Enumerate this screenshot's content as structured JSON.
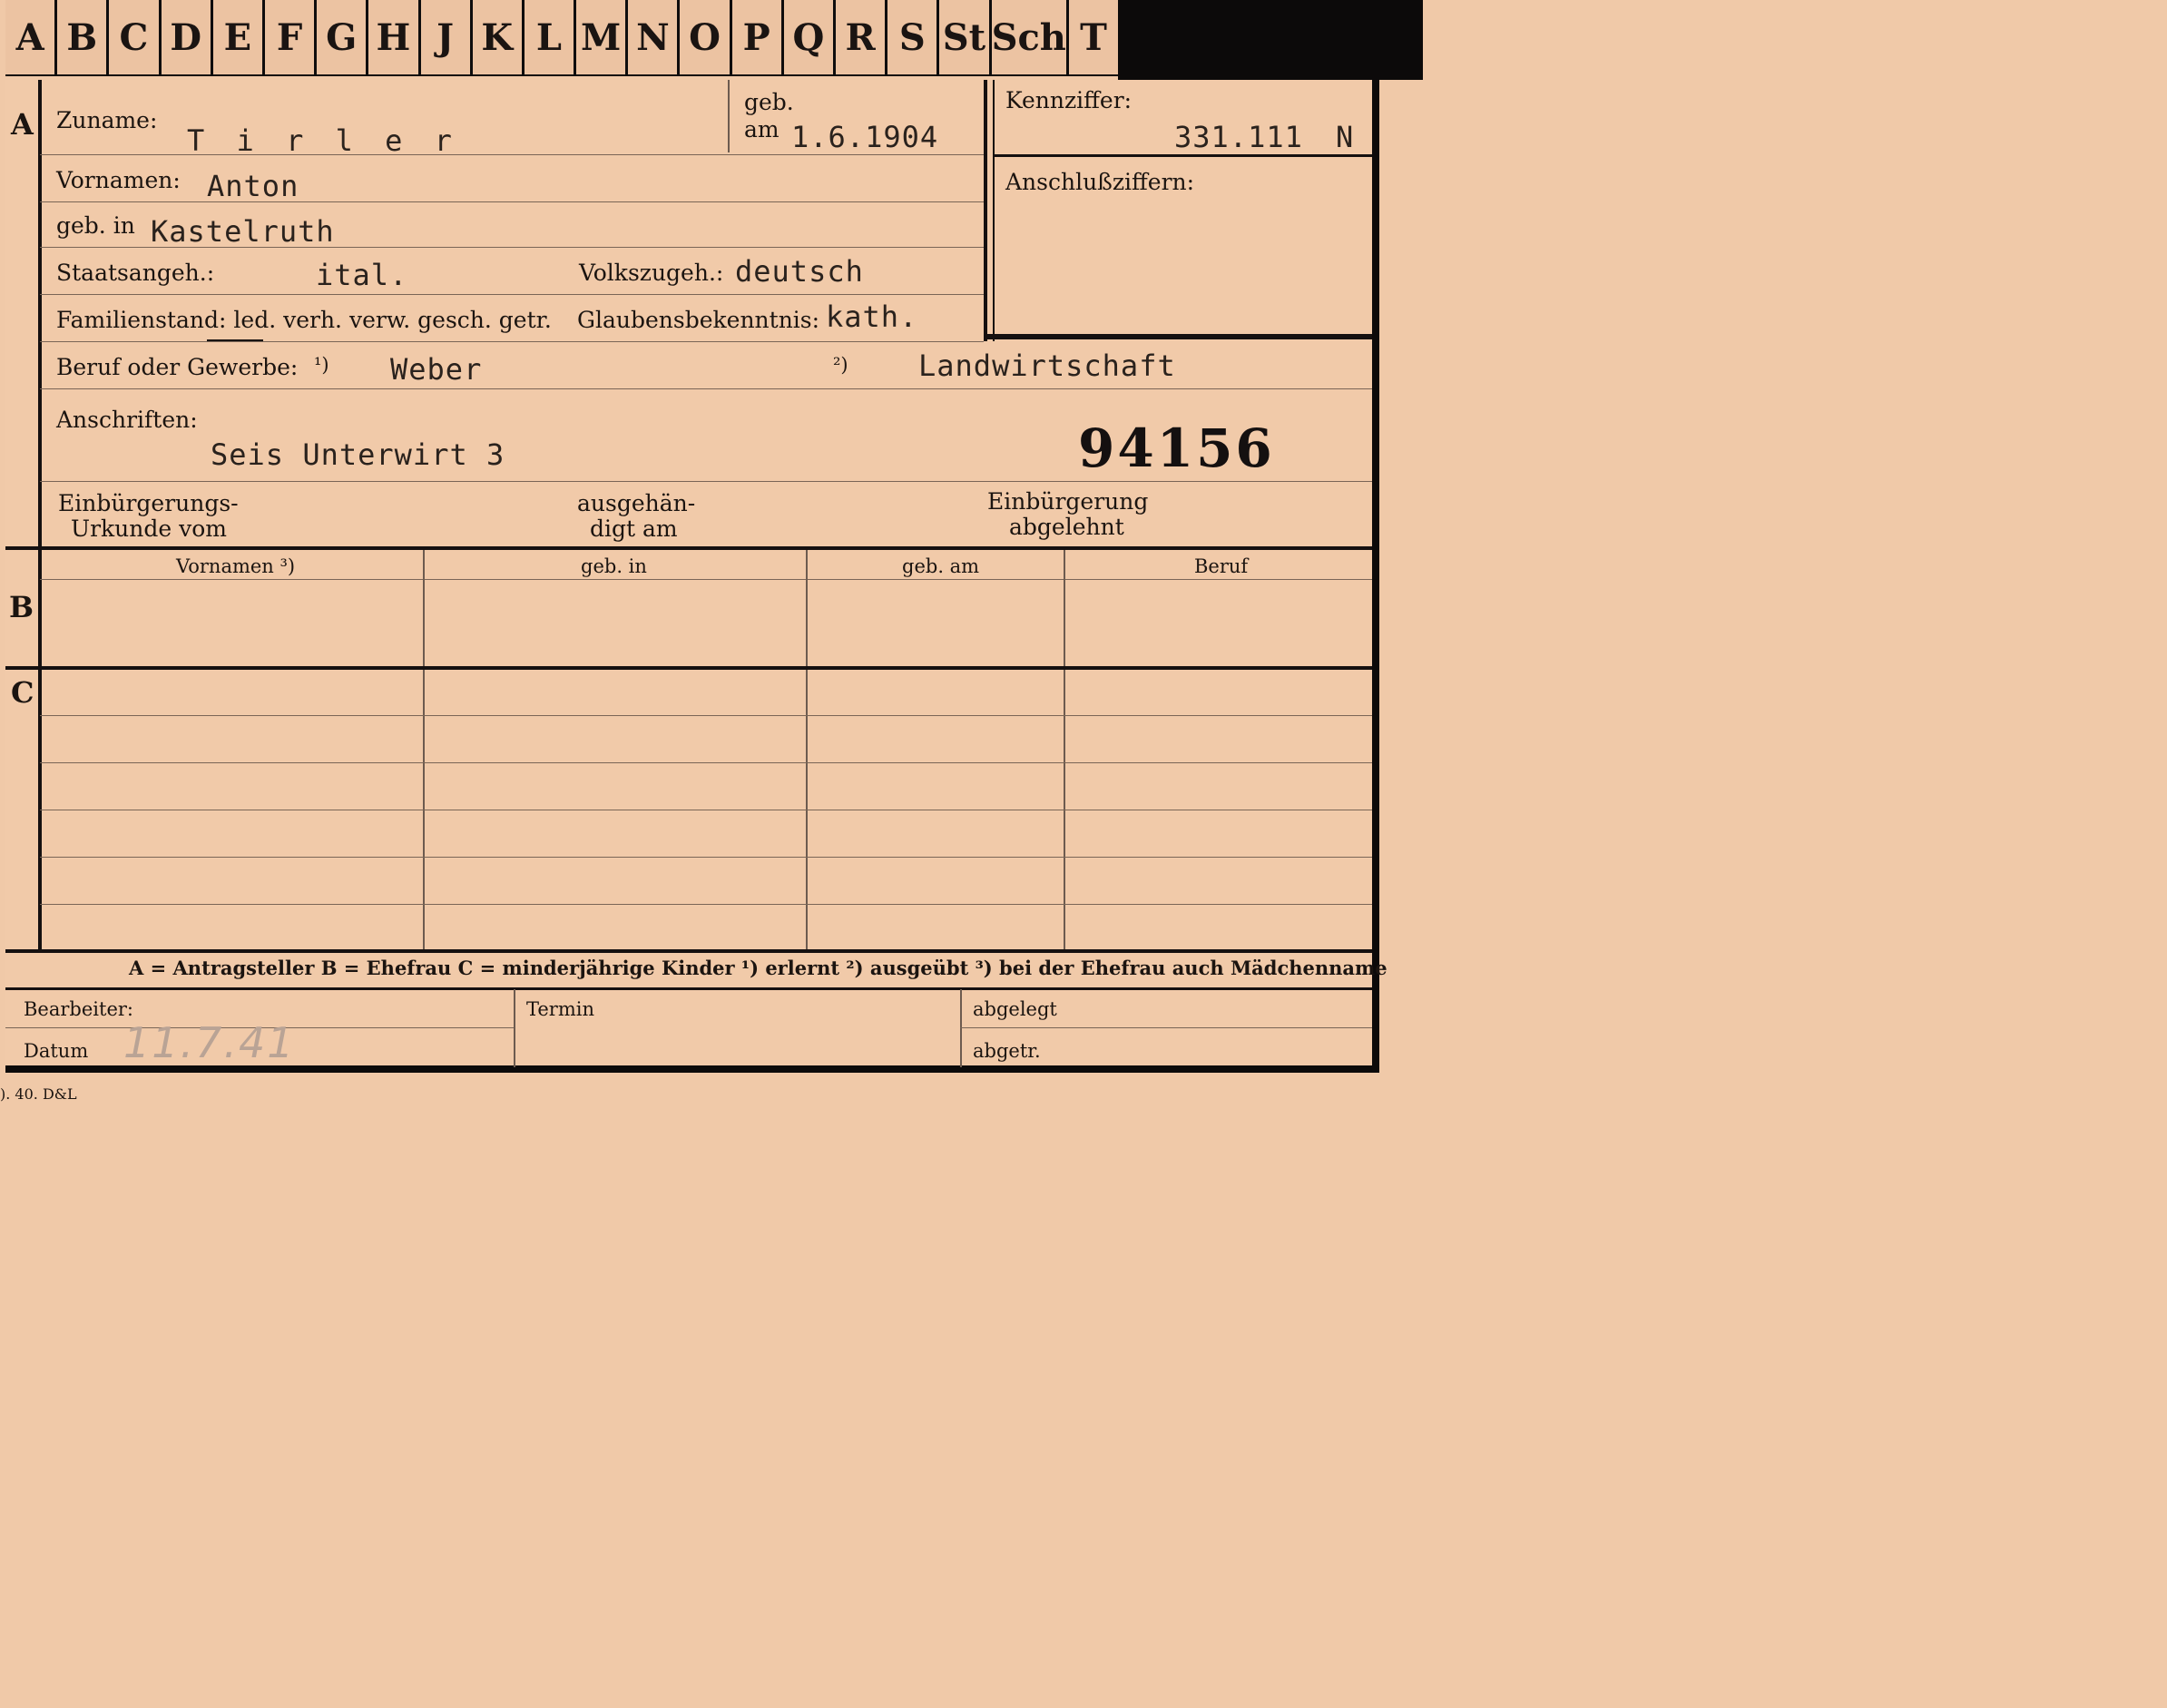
{
  "tabs": [
    "A",
    "B",
    "C",
    "D",
    "E",
    "F",
    "G",
    "H",
    "J",
    "K",
    "L",
    "M",
    "N",
    "O",
    "P",
    "Q",
    "R",
    "S",
    "St",
    "Sch",
    "T"
  ],
  "sections": {
    "a": "A",
    "b": "B",
    "c": "C"
  },
  "fields": {
    "zuname_label": "Zuname:",
    "zuname_value": "T i r l e r",
    "geb_label": "geb.",
    "am_label": "am",
    "geb_am_value": "1.6.1904",
    "kennziffer_label": "Kennziffer:",
    "kennziffer_value": "331.111",
    "kennziffer_suffix": "N",
    "anschluss_label": "Anschlußziffern:",
    "vornamen_label": "Vornamen:",
    "vornamen_value": "Anton",
    "gebin_label": "geb. in",
    "gebin_value": "Kastelruth",
    "staats_label": "Staatsangeh.:",
    "staats_value": "ital.",
    "volks_label": "Volkszugeh.:",
    "volks_value": "deutsch",
    "familien_label": "Familienstand: led. verh. verw. gesch. getr.",
    "glaubens_label": "Glaubensbekenntnis:",
    "glaubens_value": "kath.",
    "beruf_label": "Beruf oder Gewerbe:",
    "beruf_note1": "¹)",
    "beruf_value1": "Weber",
    "beruf_note2": "²)",
    "beruf_value2": "Landwirtschaft",
    "anschriften_label": "Anschriften:",
    "anschriften_value": "Seis Unterwirt  3",
    "stamp_number": "94156",
    "einb_line1": "Einbürgerungs-",
    "einb_line2": "Urkunde vom",
    "ausg_line1": "ausgehän-",
    "ausg_line2": "digt am",
    "abgelehnt_line1": "Einbürgerung",
    "abgelehnt_line2": "abgelehnt"
  },
  "table_headers": [
    "Vornamen ³)",
    "geb. in",
    "geb. am",
    "Beruf"
  ],
  "legend": "A = Antragsteller    B = Ehefrau    C = minderjährige Kinder    ¹) erlernt    ²) ausgeübt    ³) bei der Ehefrau auch Mädchenname",
  "footer": {
    "bearbeiter": "Bearbeiter:",
    "datum": "Datum",
    "datum_value": "11.7.41",
    "termin": "Termin",
    "abgelegt": "abgelegt",
    "abgetr": "abgetr."
  },
  "print_code": "). 40. D&L"
}
